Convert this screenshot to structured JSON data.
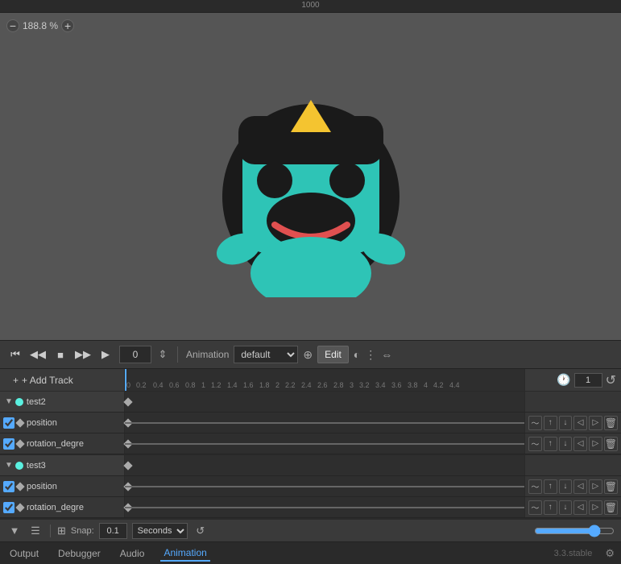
{
  "ruler": {
    "label": "1000"
  },
  "zoom": {
    "minus": "−",
    "value": "188.8 %",
    "plus": "+"
  },
  "playback": {
    "skip_back": "⏮",
    "step_back": "⏪",
    "stop": "■",
    "step_fwd": "⏩",
    "play": "▶",
    "frame": "0",
    "anim_label": "Animation",
    "anim_name": "default",
    "edit_label": "Edit",
    "icons": [
      "⊕",
      "◐",
      "⋮",
      "⇔"
    ]
  },
  "timeline": {
    "add_track_label": "+ Add Track",
    "loop_count": "1",
    "loop_icon": "↺",
    "markers": [
      "0",
      "0.20.40.60.8",
      "1",
      "1.21.41.61.8",
      "2",
      "2.22.42.62.8",
      "3",
      "3.23.43.63.8",
      "4",
      "4.24.4"
    ]
  },
  "tracks": [
    {
      "group_name": "test2",
      "color": "#5af0e0",
      "children": [
        {
          "name": "position",
          "has_keyframe": true
        },
        {
          "name": "rotation_degre",
          "has_keyframe": true
        }
      ]
    },
    {
      "group_name": "test3",
      "color": "#5af0e0",
      "children": [
        {
          "name": "position",
          "has_keyframe": true
        },
        {
          "name": "rotation_degre",
          "has_keyframe": true
        }
      ]
    }
  ],
  "bottom": {
    "filter_icon": "▼",
    "list_icon": "☰",
    "snap_label": "Snap:",
    "snap_value": "0.1",
    "seconds_label": "Seconds",
    "loop_icon": "↺",
    "zoom_min": "0",
    "zoom_max": "100",
    "zoom_value": "80"
  },
  "footer": {
    "tabs": [
      "Output",
      "Debugger",
      "Audio",
      "Animation"
    ],
    "active_tab": "Animation",
    "version": "3.3.stable",
    "settings_icon": "⚙"
  }
}
